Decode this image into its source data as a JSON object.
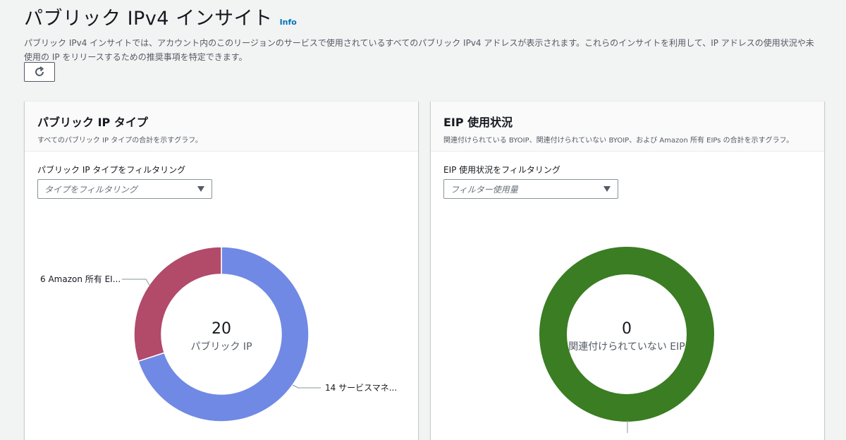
{
  "header": {
    "title": "パブリック IPv4 インサイト",
    "info_label": "Info",
    "description": "パブリック IPv4 インサイトでは、アカウント内のこのリージョンのサービスで使用されているすべてのパブリック IPv4 アドレスが表示されます。これらのインサイトを利用して、IP アドレスの使用状況や未使用の IP をリリースするための推奨事項を特定できます。"
  },
  "toolbar": {
    "refresh_icon": "refresh-icon"
  },
  "panels": {
    "ip_types": {
      "title": "パブリック IP タイプ",
      "subtitle": "すべてのパブリック IP タイプの合計を示すグラフ。",
      "filter_label": "パブリック IP タイプをフィルタリング",
      "filter_placeholder": "タイプをフィルタリング",
      "center_value": "20",
      "center_label": "パブリック IP"
    },
    "eip_usage": {
      "title": "EIP 使用状況",
      "subtitle": "関連付けられている BYOIP、関連付けられていない BYOIP、および Amazon 所有 EIPs の合計を示すグラフ。",
      "filter_label": "EIP 使用状況をフィルタリング",
      "filter_placeholder": "フィルター使用量",
      "center_value": "0",
      "center_label": "関連付けられていない EIP"
    }
  },
  "chart_data": [
    {
      "type": "pie",
      "center_text": "20",
      "center_subtext": "パブリック IP",
      "slices": [
        {
          "label": "14 サービスマネ...",
          "value": 14,
          "color": "#7089e4"
        },
        {
          "label": "6 Amazon 所有 EI...",
          "value": 6,
          "color": "#b24a6a"
        }
      ]
    },
    {
      "type": "pie",
      "center_text": "0",
      "center_subtext": "関連付けられていない EIP",
      "slices": [
        {
          "value": 1,
          "color": "#3a7d22"
        }
      ]
    }
  ]
}
